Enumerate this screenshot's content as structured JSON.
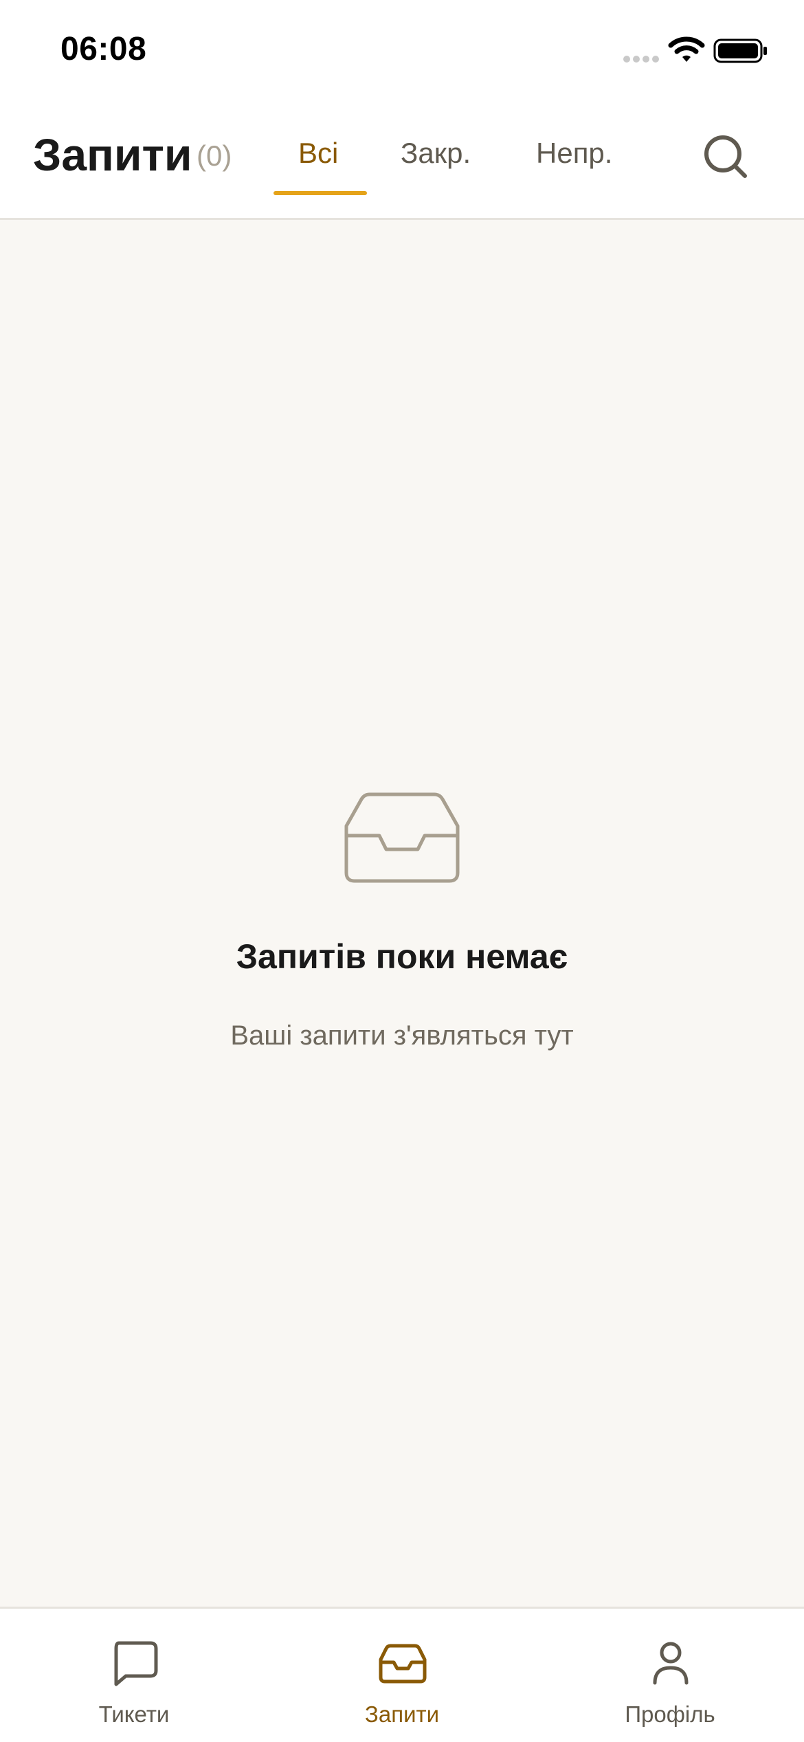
{
  "status_bar": {
    "time": "06:08"
  },
  "header": {
    "title": "Запити",
    "count": "(0)",
    "tabs": [
      {
        "label": "Всі",
        "active": true
      },
      {
        "label": "Закр.",
        "active": false
      },
      {
        "label": "Непр.",
        "active": false
      }
    ],
    "search_icon": "search-icon"
  },
  "empty_state": {
    "icon": "inbox-icon",
    "title": "Запитів поки немає",
    "subtitle": "Ваші запити з'являться тут"
  },
  "bottom_nav": {
    "items": [
      {
        "label": "Тикети",
        "icon": "chat-bubble-icon",
        "active": false
      },
      {
        "label": "Запити",
        "icon": "inbox-icon",
        "active": true
      },
      {
        "label": "Профіль",
        "icon": "user-icon",
        "active": false
      }
    ]
  },
  "colors": {
    "accent": "#e5a319",
    "accent_text": "#8a5a06",
    "background": "#f9f7f3",
    "muted_text": "#6f695e",
    "icon_muted": "#a89f8f"
  }
}
